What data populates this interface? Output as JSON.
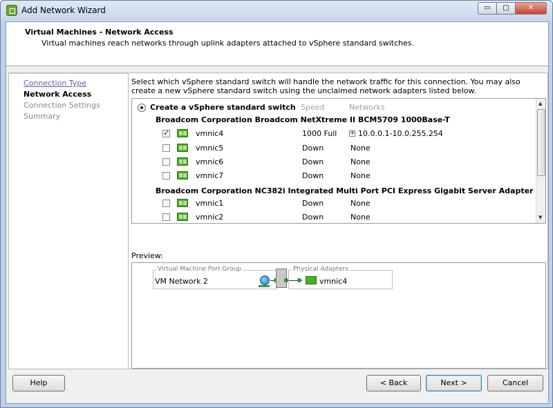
{
  "window": {
    "title": "Add Network Wizard",
    "minimize": "▭",
    "maximize": "□",
    "close": "✕"
  },
  "header": {
    "title": "Virtual Machines - Network Access",
    "subtitle": "Virtual machines reach networks through uplink adapters attached to vSphere standard switches."
  },
  "nav": {
    "items": [
      {
        "label": "Connection Type"
      },
      {
        "label": "Network Access"
      },
      {
        "label": "Connection Settings"
      },
      {
        "label": "Summary"
      }
    ]
  },
  "content": {
    "instructions": "Select which vSphere standard switch will handle the network traffic for this connection. You may also create a new vSphere standard switch using the unclaimed network adapters listed below.",
    "option_label": "Create a vSphere standard switch",
    "col_speed": "Speed",
    "col_networks": "Networks",
    "groups": [
      {
        "title": "Broadcom Corporation Broadcom NetXtreme II BCM5709 1000Base-T"
      },
      {
        "title": "Broadcom Corporation NC382i Integrated Multi Port PCI Express Gigabit Server Adapter"
      }
    ],
    "nics": [
      {
        "name": "vmnic4",
        "speed": "1000 Full",
        "networks": "10.0.0.1-10.0.255.254",
        "checked": true
      },
      {
        "name": "vmnic5",
        "speed": "Down",
        "networks": "None",
        "checked": false
      },
      {
        "name": "vmnic6",
        "speed": "Down",
        "networks": "None",
        "checked": false
      },
      {
        "name": "vmnic7",
        "speed": "Down",
        "networks": "None",
        "checked": false
      },
      {
        "name": "vmnic1",
        "speed": "Down",
        "networks": "None",
        "checked": false
      },
      {
        "name": "vmnic2",
        "speed": "Down",
        "networks": "None",
        "checked": false
      }
    ],
    "expander": "+"
  },
  "preview": {
    "label": "Preview:",
    "port_group_caption": "Virtual Machine Port Group",
    "port_group_name": "VM Network 2",
    "physical_caption": "Physical Adapters",
    "physical_nic": "vmnic4"
  },
  "footer": {
    "help": "Help",
    "back": "< Back",
    "next": "Next >",
    "cancel": "Cancel"
  }
}
